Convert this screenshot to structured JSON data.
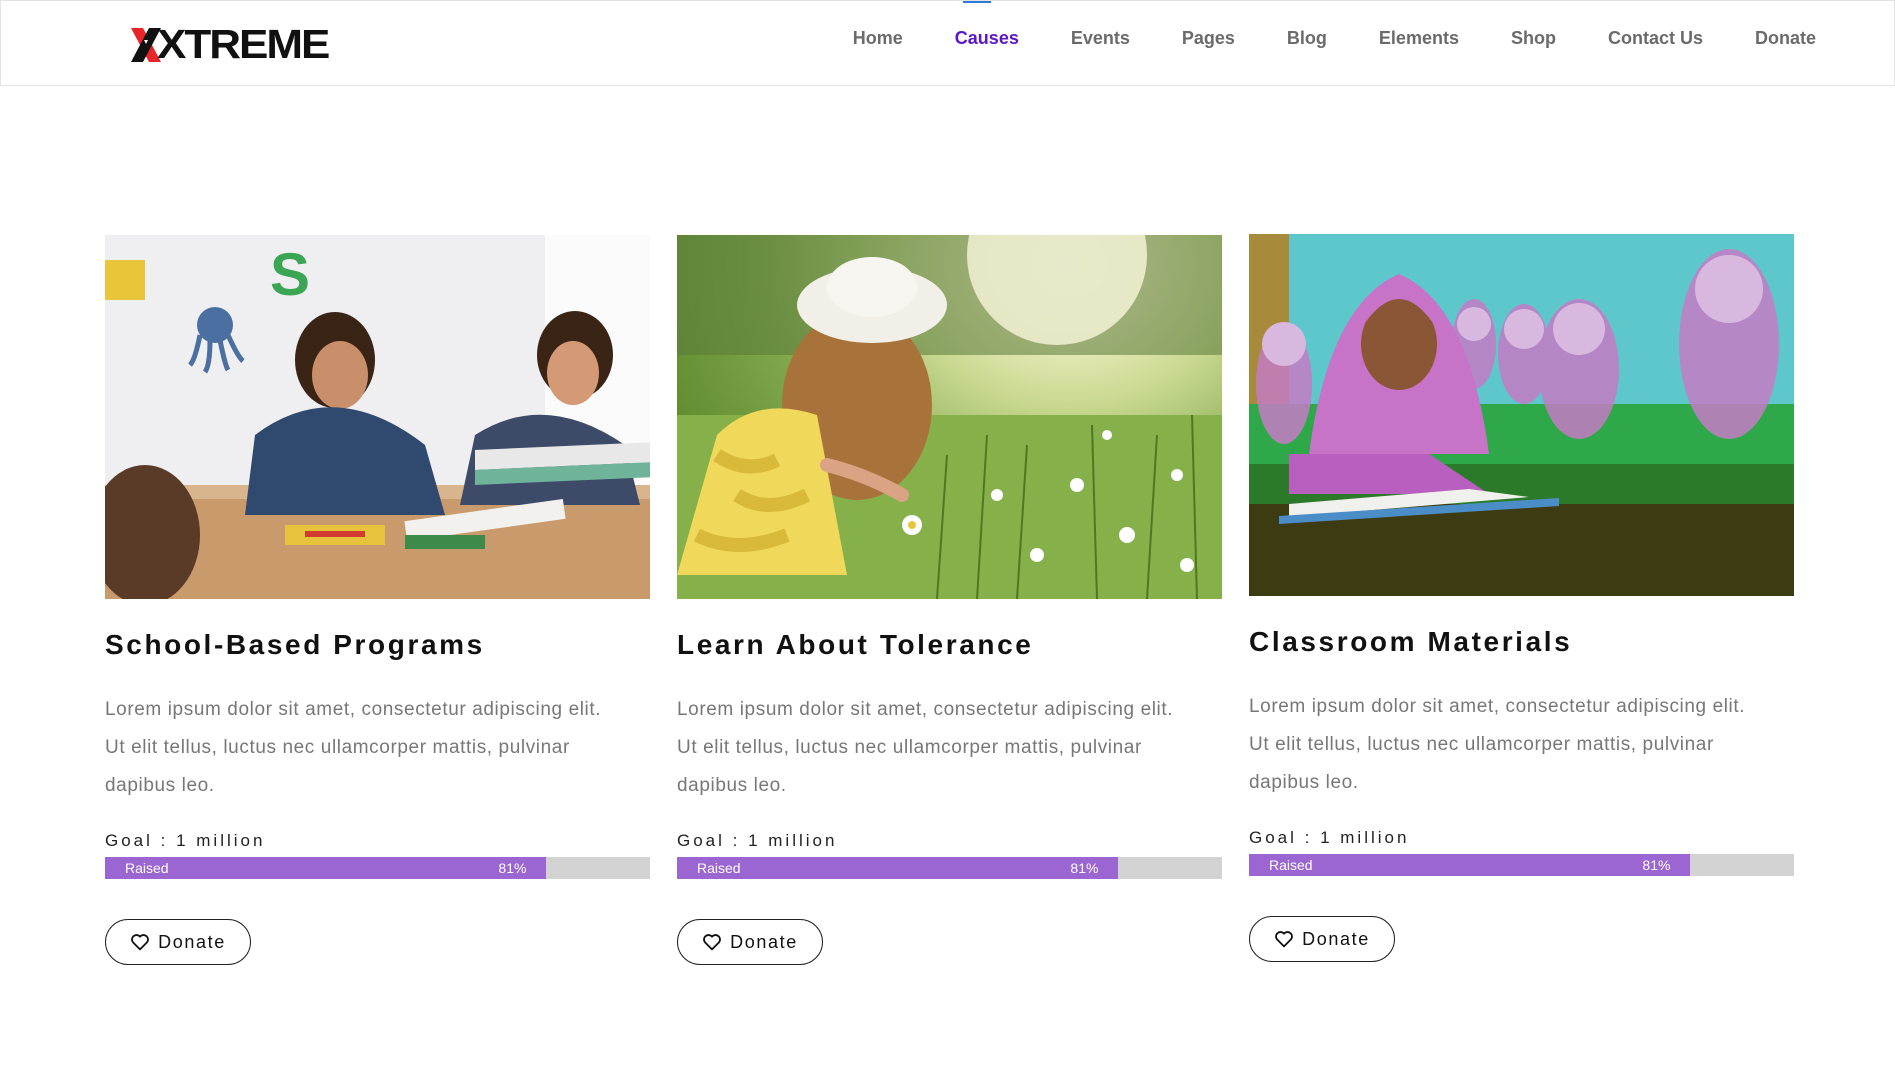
{
  "brand": {
    "logo_text": "XTREME",
    "accent": "#e8262a"
  },
  "nav": {
    "items": [
      "Home",
      "Causes",
      "Events",
      "Pages",
      "Blog",
      "Elements",
      "Shop",
      "Contact Us",
      "Donate"
    ],
    "active": "Causes",
    "active_color": "#5b16c8"
  },
  "cards": [
    {
      "title": "School-Based Programs",
      "description": "Lorem ipsum dolor sit amet, consectetur adipiscing elit. Ut elit tellus, luctus nec ullamcorper mattis, pulvinar dapibus leo.",
      "goal": "Goal : 1 million",
      "raised_label": "Raised",
      "progress": 0.81,
      "progress_text": "81%",
      "button": "Donate",
      "image": "children-drawing-classroom"
    },
    {
      "title": "Learn About Tolerance",
      "description": "Lorem ipsum dolor sit amet, consectetur adipiscing elit. Ut elit tellus, luctus nec ullamcorper mattis, pulvinar dapibus leo.",
      "goal": "Goal : 1 million",
      "raised_label": "Raised",
      "progress": 0.81,
      "progress_text": "81%",
      "button": "Donate",
      "image": "girl-in-flower-meadow"
    },
    {
      "title": "Classroom Materials",
      "description": "Lorem ipsum dolor sit amet, consectetur adipiscing elit. Ut elit tellus, luctus nec ullamcorper mattis, pulvinar dapibus leo.",
      "goal": "Goal : 1 million",
      "raised_label": "Raised",
      "progress": 0.81,
      "progress_text": "81%",
      "button": "Donate",
      "image": "girls-reading-in-class"
    }
  ],
  "colors": {
    "progress_fill": "#9b66d2",
    "progress_track": "#d3d3d3"
  }
}
